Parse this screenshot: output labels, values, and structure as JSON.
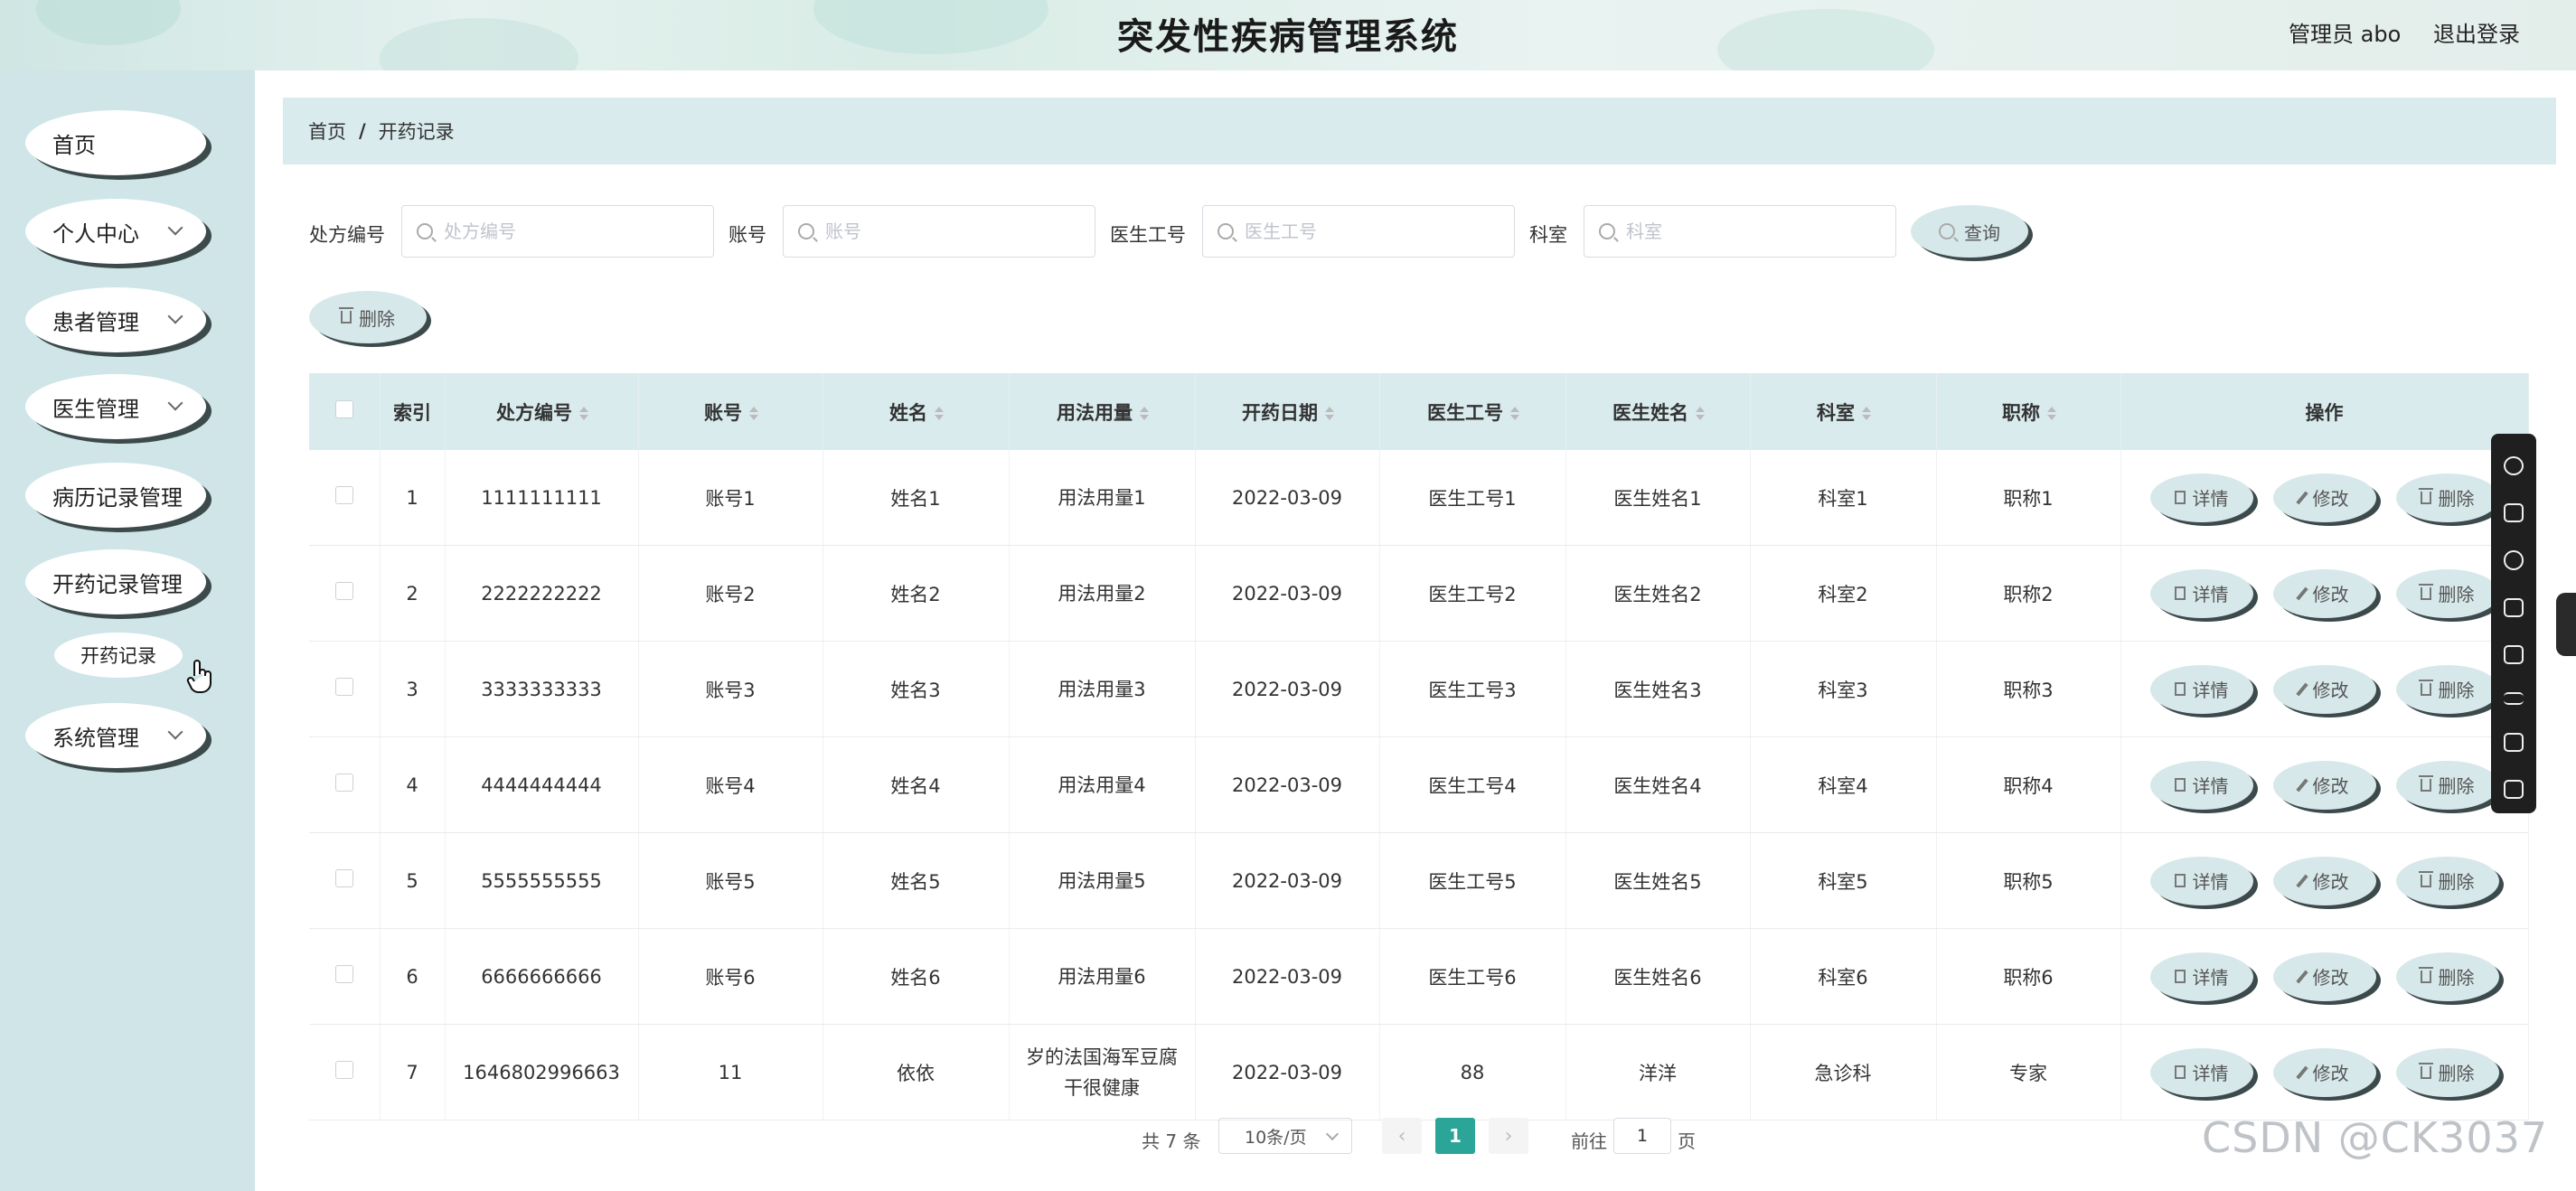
{
  "header": {
    "title": "突发性疾病管理系统",
    "admin": "管理员 abo",
    "logout": "退出登录"
  },
  "sidebar": {
    "items": [
      {
        "label": "首页",
        "has_arrow": false
      },
      {
        "label": "个人中心",
        "has_arrow": true
      },
      {
        "label": "患者管理",
        "has_arrow": true
      },
      {
        "label": "医生管理",
        "has_arrow": true
      },
      {
        "label": "病历记录管理",
        "has_arrow": false
      },
      {
        "label": "开药记录管理",
        "has_arrow": false
      },
      {
        "label": "系统管理",
        "has_arrow": true
      }
    ],
    "submenu": {
      "label": "开药记录"
    }
  },
  "breadcrumb": {
    "home": "首页",
    "sep": "/",
    "current": "开药记录"
  },
  "search": {
    "fields": [
      {
        "label": "处方编号",
        "placeholder": "处方编号",
        "value": ""
      },
      {
        "label": "账号",
        "placeholder": "账号",
        "value": ""
      },
      {
        "label": "医生工号",
        "placeholder": "医生工号",
        "value": ""
      },
      {
        "label": "科室",
        "placeholder": "科室",
        "value": ""
      }
    ],
    "query_label": "查询"
  },
  "toolbar": {
    "delete_label": "删除"
  },
  "table": {
    "headers": [
      "索引",
      "处方编号",
      "账号",
      "姓名",
      "用法用量",
      "开药日期",
      "医生工号",
      "医生姓名",
      "科室",
      "职称",
      "操作"
    ],
    "rows": [
      [
        "1",
        "1111111111",
        "账号1",
        "姓名1",
        "用法用量1",
        "2022-03-09",
        "医生工号1",
        "医生姓名1",
        "科室1",
        "职称1"
      ],
      [
        "2",
        "2222222222",
        "账号2",
        "姓名2",
        "用法用量2",
        "2022-03-09",
        "医生工号2",
        "医生姓名2",
        "科室2",
        "职称2"
      ],
      [
        "3",
        "3333333333",
        "账号3",
        "姓名3",
        "用法用量3",
        "2022-03-09",
        "医生工号3",
        "医生姓名3",
        "科室3",
        "职称3"
      ],
      [
        "4",
        "4444444444",
        "账号4",
        "姓名4",
        "用法用量4",
        "2022-03-09",
        "医生工号4",
        "医生姓名4",
        "科室4",
        "职称4"
      ],
      [
        "5",
        "5555555555",
        "账号5",
        "姓名5",
        "用法用量5",
        "2022-03-09",
        "医生工号5",
        "医生姓名5",
        "科室5",
        "职称5"
      ],
      [
        "6",
        "6666666666",
        "账号6",
        "姓名6",
        "用法用量6",
        "2022-03-09",
        "医生工号6",
        "医生姓名6",
        "科室6",
        "职称6"
      ],
      [
        "7",
        "1646802996663",
        "11",
        "依依",
        "岁的法国海军豆腐干很健康",
        "2022-03-09",
        "88",
        "洋洋",
        "急诊科",
        "专家"
      ]
    ],
    "actions": {
      "detail": "详情",
      "edit": "修改",
      "delete": "删除"
    }
  },
  "pagination": {
    "total": "共 7 条",
    "page_size": "10条/页",
    "current_page": "1",
    "goto_prefix": "前往",
    "goto_value": "1",
    "goto_suffix": "页",
    "prev": "‹",
    "next": "›"
  },
  "watermark": "CSDN @CK3037",
  "colors": {
    "accent": "#2aa597",
    "panel": "#d9ebed",
    "sidebar": "#cfe5e8",
    "shadow": "#3c4a4c"
  }
}
